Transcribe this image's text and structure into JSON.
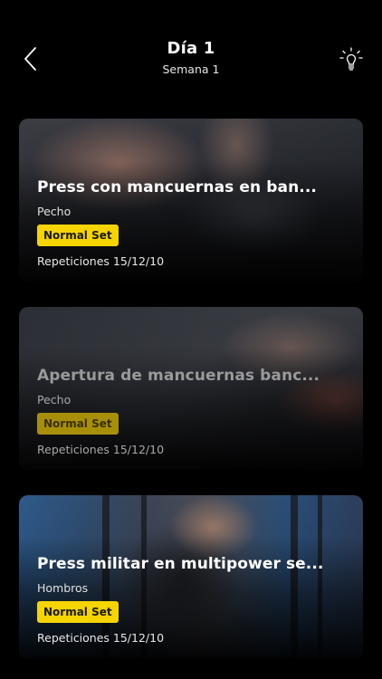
{
  "header": {
    "title": "Día 1",
    "subtitle": "Semana 1",
    "back_icon": "chevron-left-icon",
    "tip_icon": "lightbulb-icon"
  },
  "exercises": [
    {
      "name": "Press con mancuernas en ban...",
      "muscle": "Pecho",
      "set_type": "Normal Set",
      "reps": "Repeticiones 15/12/10",
      "dimmed": false
    },
    {
      "name": "Apertura de mancuernas banc...",
      "muscle": "Pecho",
      "set_type": "Normal Set",
      "reps": "Repeticiones 15/12/10",
      "dimmed": true
    },
    {
      "name": "Press militar en multipower se...",
      "muscle": "Hombros",
      "set_type": "Normal Set",
      "reps": "Repeticiones 15/12/10",
      "dimmed": false
    }
  ],
  "colors": {
    "background": "#000000",
    "badge": "#f5d400",
    "text": "#ffffff"
  }
}
